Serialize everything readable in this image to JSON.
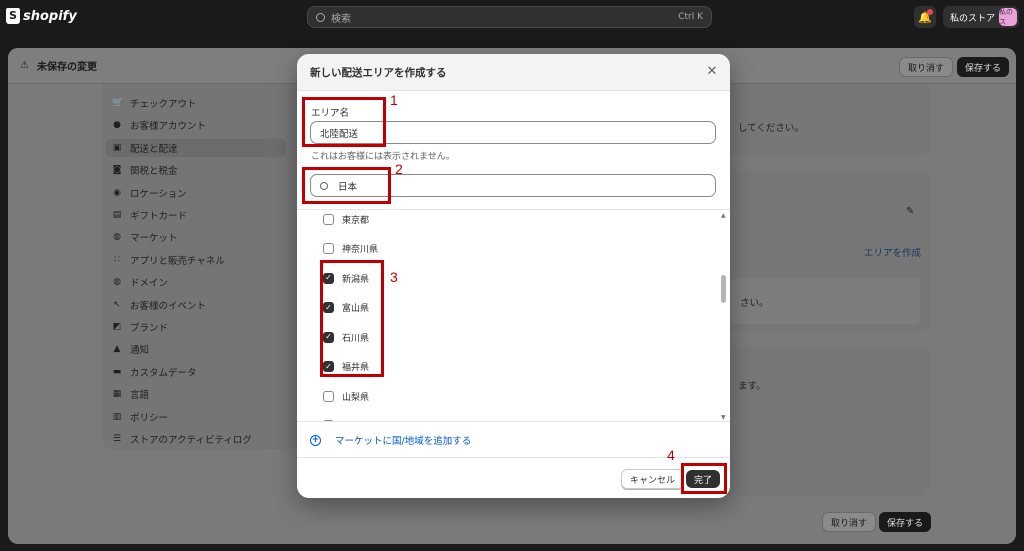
{
  "topbar": {
    "brand": "shopify",
    "search_placeholder": "検索",
    "search_shortcut": "Ctrl K",
    "store_name": "私のストア",
    "avatar_initials": "私のス"
  },
  "page": {
    "unsaved_title": "未保存の変更",
    "discard_label": "取り消す",
    "save_label": "保存する",
    "bottom_discard_label": "取り消す",
    "bottom_save_label": "保存する",
    "sidebar_items": [
      {
        "label": "チェックアウト",
        "icon": "cart-icon"
      },
      {
        "label": "お客様アカウント",
        "icon": "person-icon"
      },
      {
        "label": "配送と配達",
        "icon": "truck-icon"
      },
      {
        "label": "関税と税金",
        "icon": "money-bag-icon"
      },
      {
        "label": "ロケーション",
        "icon": "location-icon"
      },
      {
        "label": "ギフトカード",
        "icon": "gift-card-icon"
      },
      {
        "label": "マーケット",
        "icon": "globe-icon"
      },
      {
        "label": "アプリと販売チャネル",
        "icon": "apps-icon"
      },
      {
        "label": "ドメイン",
        "icon": "globe-icon"
      },
      {
        "label": "お客様のイベント",
        "icon": "cursor-icon"
      },
      {
        "label": "ブランド",
        "icon": "brand-icon"
      },
      {
        "label": "通知",
        "icon": "bell-icon"
      },
      {
        "label": "カスタムデータ",
        "icon": "database-icon"
      },
      {
        "label": "言語",
        "icon": "language-icon"
      },
      {
        "label": "ポリシー",
        "icon": "policy-icon"
      },
      {
        "label": "ストアのアクティビティログ",
        "icon": "list-icon"
      }
    ],
    "card_text_1": "してください。",
    "create_zone_link": "エリアを作成",
    "card_text_2": "さい。",
    "card_text_3": "ます。"
  },
  "modal": {
    "title": "新しい配送エリアを作成する",
    "zone_name_label": "エリア名",
    "zone_name_value": "北陸配送",
    "zone_name_help": "これはお客様には表示されません。",
    "search_value": "日本",
    "prefectures": [
      {
        "name": "東京都",
        "checked": false
      },
      {
        "name": "神奈川県",
        "checked": false
      },
      {
        "name": "新潟県",
        "checked": true
      },
      {
        "name": "富山県",
        "checked": true
      },
      {
        "name": "石川県",
        "checked": true
      },
      {
        "name": "福井県",
        "checked": true
      },
      {
        "name": "山梨県",
        "checked": false
      },
      {
        "name": "長野県",
        "checked": false
      }
    ],
    "add_market_label": "マーケットに国/地域を追加する",
    "cancel_label": "キャンセル",
    "done_label": "完了"
  },
  "annotations": [
    "1",
    "2",
    "3",
    "4"
  ],
  "colors": {
    "annotation": "#c00000",
    "link": "#005bd3",
    "primary_button": "#303030"
  }
}
